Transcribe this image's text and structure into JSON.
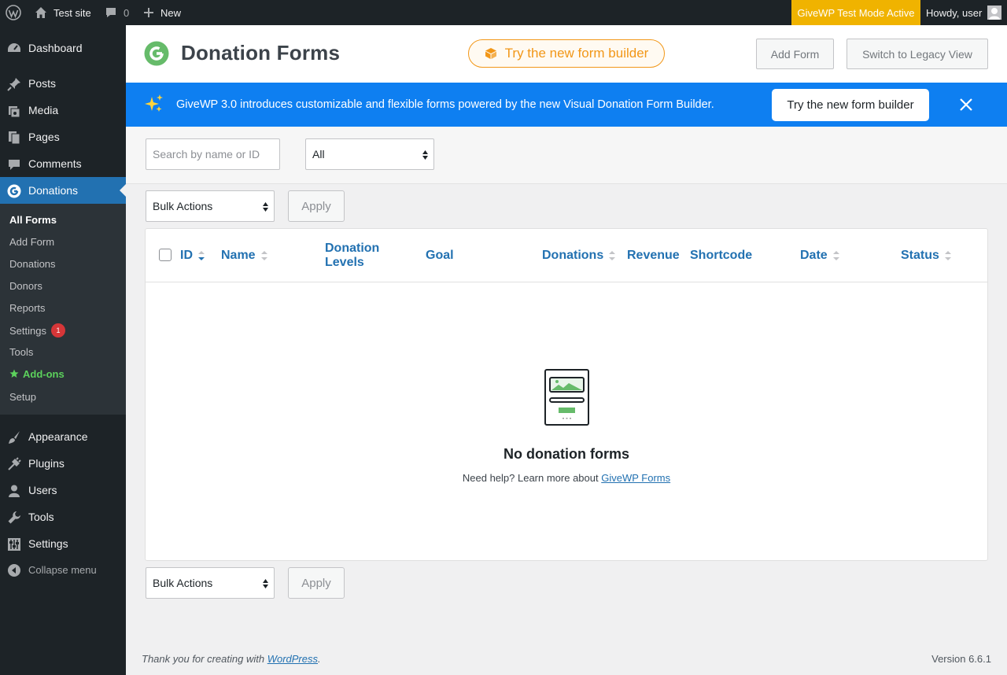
{
  "adminbar": {
    "site_name": "Test site",
    "comments_count": "0",
    "new_label": "New",
    "test_mode": "GiveWP Test Mode Active",
    "howdy": "Howdy, user"
  },
  "sidebar": {
    "items": [
      {
        "label": "Dashboard",
        "icon": "dashboard-icon"
      },
      {
        "label": "Posts",
        "icon": "pin-icon"
      },
      {
        "label": "Media",
        "icon": "media-icon"
      },
      {
        "label": "Pages",
        "icon": "pages-icon"
      },
      {
        "label": "Comments",
        "icon": "comment-icon"
      },
      {
        "label": "Donations",
        "icon": "givewp-icon"
      }
    ],
    "submenu": [
      {
        "label": "All Forms"
      },
      {
        "label": "Add Form"
      },
      {
        "label": "Donations"
      },
      {
        "label": "Donors"
      },
      {
        "label": "Reports"
      },
      {
        "label": "Settings",
        "badge": "1"
      },
      {
        "label": "Tools"
      },
      {
        "label": "Add-ons"
      },
      {
        "label": "Setup"
      }
    ],
    "bottom_items": [
      {
        "label": "Appearance",
        "icon": "brush-icon"
      },
      {
        "label": "Plugins",
        "icon": "plugin-icon"
      },
      {
        "label": "Users",
        "icon": "user-icon"
      },
      {
        "label": "Tools",
        "icon": "wrench-icon"
      },
      {
        "label": "Settings",
        "icon": "settings-icon"
      }
    ],
    "collapse_label": "Collapse menu"
  },
  "header": {
    "title": "Donation Forms",
    "try_builder": "Try the new form builder",
    "add_form": "Add Form",
    "legacy_view": "Switch to Legacy View"
  },
  "banner": {
    "text": "GiveWP 3.0 introduces customizable and flexible forms powered by the new Visual Donation Form Builder.",
    "button": "Try the new form builder",
    "bg_color": "#0e7ff1"
  },
  "filters": {
    "search_placeholder": "Search by name or ID",
    "status_value": "All"
  },
  "bulk": {
    "actions_label": "Bulk Actions",
    "apply_label": "Apply"
  },
  "table": {
    "columns": [
      "ID",
      "Name",
      "Donation Levels",
      "Goal",
      "Donations",
      "Revenue",
      "Shortcode",
      "Date",
      "Status"
    ],
    "empty_title": "No donation forms",
    "empty_help_prefix": "Need help? Learn more about ",
    "empty_help_link": "GiveWP Forms"
  },
  "footer": {
    "thanks_prefix": "Thank you for creating with ",
    "thanks_link": "WordPress",
    "thanks_suffix": ".",
    "version": "Version 6.6.1"
  }
}
